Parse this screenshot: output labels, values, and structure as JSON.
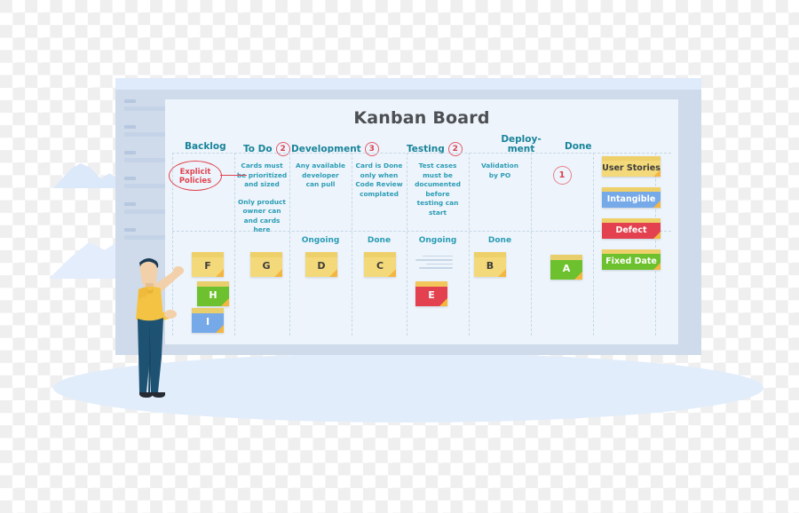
{
  "board": {
    "title": "Kanban Board",
    "accent_teal": "#18849a",
    "accent_red": "#d9414f",
    "panel_bg": "#eef4fb",
    "frame_bg": "#cfdbea"
  },
  "columns": [
    {
      "id": "backlog",
      "label": "Backlog",
      "wip": null,
      "policy": "",
      "sub": []
    },
    {
      "id": "todo",
      "label": "To Do",
      "wip": "2",
      "policy": "Cards must\nbe prioritized\nand sized\n\nOnly product\nowner can\nand cards here",
      "sub": []
    },
    {
      "id": "development",
      "label": "Development",
      "wip": "3",
      "policy": "Any available\ndeveloper\ncan pull",
      "sub": [
        "Ongoing",
        "Done"
      ]
    },
    {
      "id": "development2",
      "label": "",
      "wip": null,
      "policy": "Card is Done\nonly when\nCode Review\ncomplated",
      "sub": []
    },
    {
      "id": "testing",
      "label": "Testing",
      "wip": "2",
      "policy": "Test cases\nmust be\ndocumented\nbefore\ntesting can\nstart",
      "sub": [
        "Ongoing",
        "Done"
      ]
    },
    {
      "id": "testing2",
      "label": "",
      "wip": null,
      "policy": "Validation\nby PO",
      "sub": []
    },
    {
      "id": "deployment",
      "label": "Deploy-\nment",
      "wip": "1",
      "policy": "",
      "sub": []
    },
    {
      "id": "done",
      "label": "Done",
      "wip": null,
      "policy": "",
      "sub": []
    }
  ],
  "column_labels": {
    "backlog": "Backlog",
    "todo": "To Do",
    "development": "Development",
    "testing": "Testing",
    "deployment_line1": "Deploy-",
    "deployment_line2": "ment",
    "done": "Done"
  },
  "wip_limits": {
    "todo": "2",
    "development": "3",
    "testing": "2",
    "deployment": "1"
  },
  "policies": {
    "todo_1": "Cards must",
    "todo_2": "be prioritized",
    "todo_3": "and sized",
    "todo_4": "Only product",
    "todo_5": "owner can",
    "todo_6": "and cards here",
    "dev_ongoing_1": "Any available",
    "dev_ongoing_2": "developer",
    "dev_ongoing_3": "can pull",
    "dev_done_1": "Card is Done",
    "dev_done_2": "only when",
    "dev_done_3": "Code Review",
    "dev_done_4": "complated",
    "test_ongoing_1": "Test cases",
    "test_ongoing_2": "must be",
    "test_ongoing_3": "documented",
    "test_ongoing_4": "before",
    "test_ongoing_5": "testing can",
    "test_ongoing_6": "start",
    "test_done_1": "Validation",
    "test_done_2": "by PO"
  },
  "callout": {
    "line1": "Explicit",
    "line2": "Policies",
    "color": "#e0434f"
  },
  "sub_headers": {
    "dev_ongoing": "Ongoing",
    "dev_done": "Done",
    "test_ongoing": "Ongoing",
    "test_done": "Done"
  },
  "cards": [
    {
      "id": "card-f",
      "label": "F",
      "column": "backlog",
      "color": "#f4d97a",
      "strip": "#eed06a",
      "text": "#3d3d3d"
    },
    {
      "id": "card-h",
      "label": "H",
      "column": "backlog",
      "color": "#6ec12e",
      "strip": "#e8cf6c",
      "text": "#ffffff"
    },
    {
      "id": "card-i",
      "label": "I",
      "column": "backlog",
      "color": "#76a9e8",
      "strip": "#e8cf6c",
      "text": "#ffffff"
    },
    {
      "id": "card-g",
      "label": "G",
      "column": "todo",
      "color": "#f4d97a",
      "strip": "#eed06a",
      "text": "#3d3d3d"
    },
    {
      "id": "card-d",
      "label": "D",
      "column": "dev-ongoing",
      "color": "#f4d97a",
      "strip": "#eed06a",
      "text": "#3d3d3d"
    },
    {
      "id": "card-c",
      "label": "C",
      "column": "dev-done",
      "color": "#f4d97a",
      "strip": "#eed06a",
      "text": "#3d3d3d"
    },
    {
      "id": "card-e",
      "label": "E",
      "column": "test-ongoing",
      "color": "#e3414f",
      "strip": "#f2c65a",
      "text": "#ffffff"
    },
    {
      "id": "card-b",
      "label": "B",
      "column": "test-done",
      "color": "#f4d97a",
      "strip": "#eed06a",
      "text": "#3d3d3d"
    },
    {
      "id": "card-a",
      "label": "A",
      "column": "done",
      "color": "#6ec12e",
      "strip": "#e8cf6c",
      "text": "#ffffff"
    }
  ],
  "legend": [
    {
      "id": "user-stories",
      "label": "User Stories",
      "color": "#f4d97a",
      "strip": "#eed06a",
      "text": "#3d3d3d"
    },
    {
      "id": "intangible",
      "label": "Intangible",
      "color": "#76a9e8",
      "strip": "#eed06a",
      "text": "#ffffff"
    },
    {
      "id": "defect",
      "label": "Defect",
      "color": "#e3414f",
      "strip": "#eed06a",
      "text": "#ffffff"
    },
    {
      "id": "fixed-date",
      "label": "Fixed Date",
      "color": "#6ec12e",
      "strip": "#eed06a",
      "text": "#ffffff"
    }
  ],
  "sidebar": {
    "placeholder_rows": 6
  },
  "person": {
    "shirt_color": "#f5c344",
    "pants_color": "#1e5273",
    "skin_color": "#f2d0a9",
    "hair_color": "#1c3b55",
    "shoe_color": "#262b33"
  }
}
